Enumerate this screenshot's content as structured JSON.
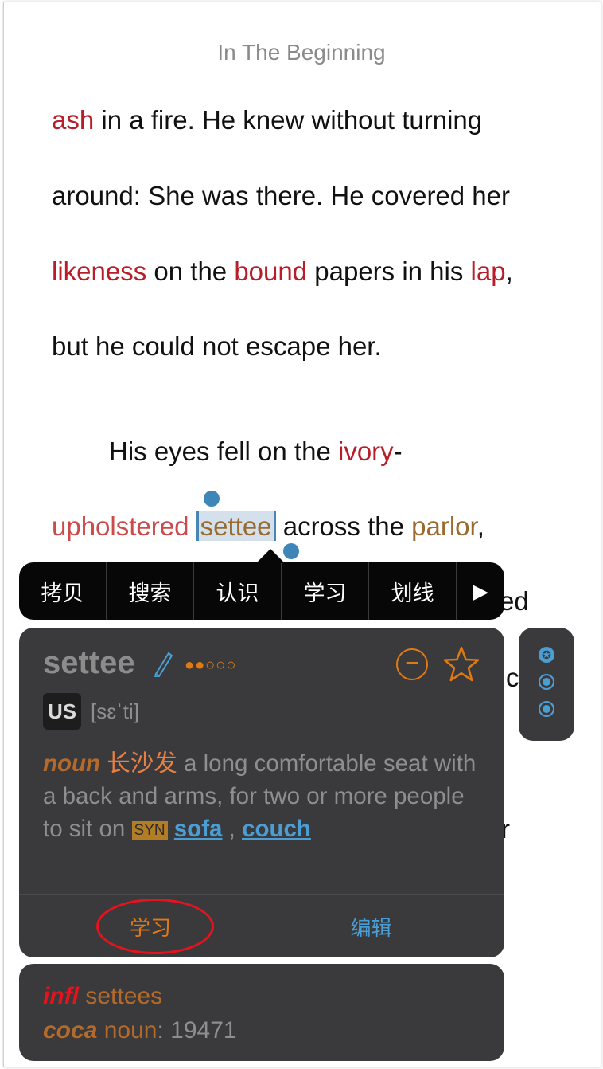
{
  "book": {
    "title": "In The Beginning"
  },
  "reading": {
    "lines": [
      {
        "parts": [
          {
            "t": "ash",
            "c": "red"
          },
          {
            "t": " in a fire. He knew without turning",
            "c": "n"
          }
        ]
      },
      {
        "parts": [
          {
            "t": "around: She was there. He covered her",
            "c": "n"
          }
        ]
      },
      {
        "parts": [
          {
            "t": "likeness",
            "c": "red"
          },
          {
            "t": " on the ",
            "c": "n"
          },
          {
            "t": "bound",
            "c": "red"
          },
          {
            "t": " papers in his ",
            "c": "n"
          },
          {
            "t": "lap",
            "c": "red"
          },
          {
            "t": ",",
            "c": "n"
          }
        ]
      },
      {
        "parts": [
          {
            "t": "but he could not escape her.",
            "c": "n"
          }
        ]
      },
      {
        "parts": [
          {
            "t": "His eyes fell on the ",
            "c": "n"
          },
          {
            "t": "ivory",
            "c": "red"
          },
          {
            "t": "-",
            "c": "n"
          }
        ]
      },
      {
        "parts": [
          {
            "t": "upholstered",
            "c": "salmon"
          },
          {
            "t": " ",
            "c": "n"
          },
          {
            "t": "settee",
            "c": "sel"
          },
          {
            "t": " across the ",
            "c": "n"
          },
          {
            "t": "parlor",
            "c": "brown"
          },
          {
            "t": ",",
            "c": "n"
          }
        ]
      }
    ],
    "obscured_fragments": [
      "ed",
      "c",
      "r"
    ]
  },
  "context_menu": {
    "items": [
      "拷贝",
      "搜索",
      "认识",
      "学习",
      "划线"
    ],
    "more_glyph": "▶"
  },
  "dictionary": {
    "headword": "settee",
    "frequency_dots": "●●○○○",
    "region": "US",
    "ipa": "[sɛˈti]",
    "pos": "noun",
    "chinese": "长沙发",
    "definition": " a long comfortable seat with a back and arms, for two or more people to sit on ",
    "syn_label": "SYN",
    "synonyms": [
      "sofa",
      "couch"
    ],
    "separator": " , ",
    "learn_label": "学习",
    "edit_label": "编辑",
    "minus_glyph": "−",
    "side_star_glyph": "✪"
  },
  "info": {
    "infl_label": "infl",
    "infl_value": "settees",
    "coca_label": "coca",
    "coca_pos": "noun",
    "coca_sep": ": ",
    "coca_rank": "19471"
  },
  "colors": {
    "word_red": "#b81e2a",
    "word_brown": "#9a6b2f",
    "accent_orange": "#e07a12",
    "accent_blue": "#4a9ed4",
    "annotation_red": "#e5131d"
  }
}
